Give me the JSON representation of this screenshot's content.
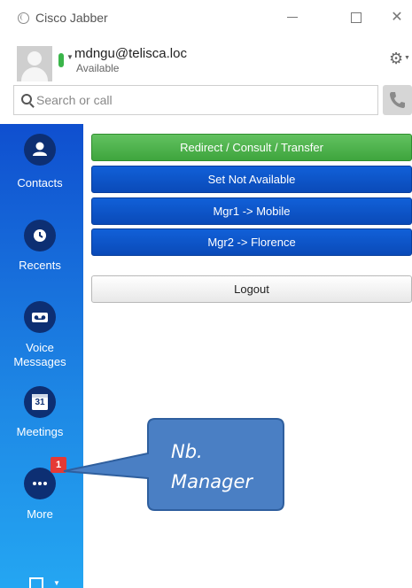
{
  "window": {
    "title": "Cisco Jabber",
    "minimize_icon": "minimize-icon",
    "maximize_icon": "maximize-icon",
    "close_icon": "close-icon",
    "close_glyph": "✕"
  },
  "account": {
    "username": "mdngu@telisca.loc",
    "status": "Available",
    "presence_color": "#3ab54a",
    "gear_glyph": "⚙"
  },
  "search": {
    "placeholder": "Search or call"
  },
  "sidebar": {
    "items": [
      {
        "label": "Contacts",
        "icon": "contacts-icon"
      },
      {
        "label": "Recents",
        "icon": "clock-icon"
      },
      {
        "label": "Voice Messages",
        "label_lines": [
          "Voice",
          "Messages"
        ],
        "icon": "voicemail-icon"
      },
      {
        "label": "Meetings",
        "icon": "calendar-icon",
        "icon_text": "31"
      },
      {
        "label": "More",
        "icon": "more-icon",
        "badge": "1"
      }
    ]
  },
  "main": {
    "buttons": [
      {
        "label": "Redirect / Consult / Transfer",
        "style": "green"
      },
      {
        "label": "Set Not Available",
        "style": "blue"
      },
      {
        "label": "Mgr1 -> Mobile",
        "style": "blue"
      },
      {
        "label": "Mgr2 -> Florence",
        "style": "blue"
      },
      {
        "label": "Logout",
        "style": "white"
      }
    ]
  },
  "callout": {
    "line1": "Nb.",
    "line2": "Manager",
    "fill": "#4a7fc4"
  },
  "colors": {
    "sidebar_top": "#0f4fcf",
    "sidebar_bottom": "#24a6f2",
    "badge": "#e53935"
  }
}
